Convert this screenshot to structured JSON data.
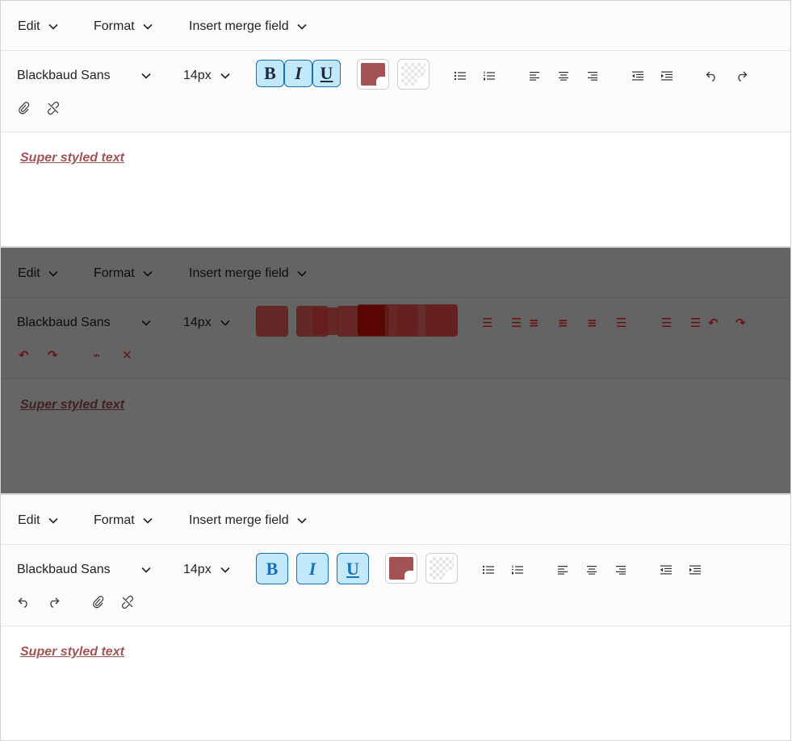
{
  "menus": {
    "edit": "Edit",
    "format": "Format",
    "insert_merge_field": "Insert merge field"
  },
  "toolbar": {
    "font_family": "Blackbaud Sans",
    "font_size": "14px",
    "bold_label": "B",
    "italic_label": "I",
    "underline_label": "U",
    "font_color": "#a25353",
    "background_color": "transparent"
  },
  "icons": [
    "chevron-down-icon",
    "bullet-list-icon",
    "numbered-list-icon",
    "align-left-icon",
    "align-center-icon",
    "align-right-icon",
    "outdent-icon",
    "indent-icon",
    "undo-icon",
    "redo-icon",
    "link-icon",
    "unlink-icon"
  ],
  "content": {
    "text": "Super styled text",
    "text_color": "#a25353"
  },
  "colors": {
    "accent_border": "#1870b8",
    "active_button_bg": "#c1e8fb",
    "highlight": "#ff4d4d"
  }
}
